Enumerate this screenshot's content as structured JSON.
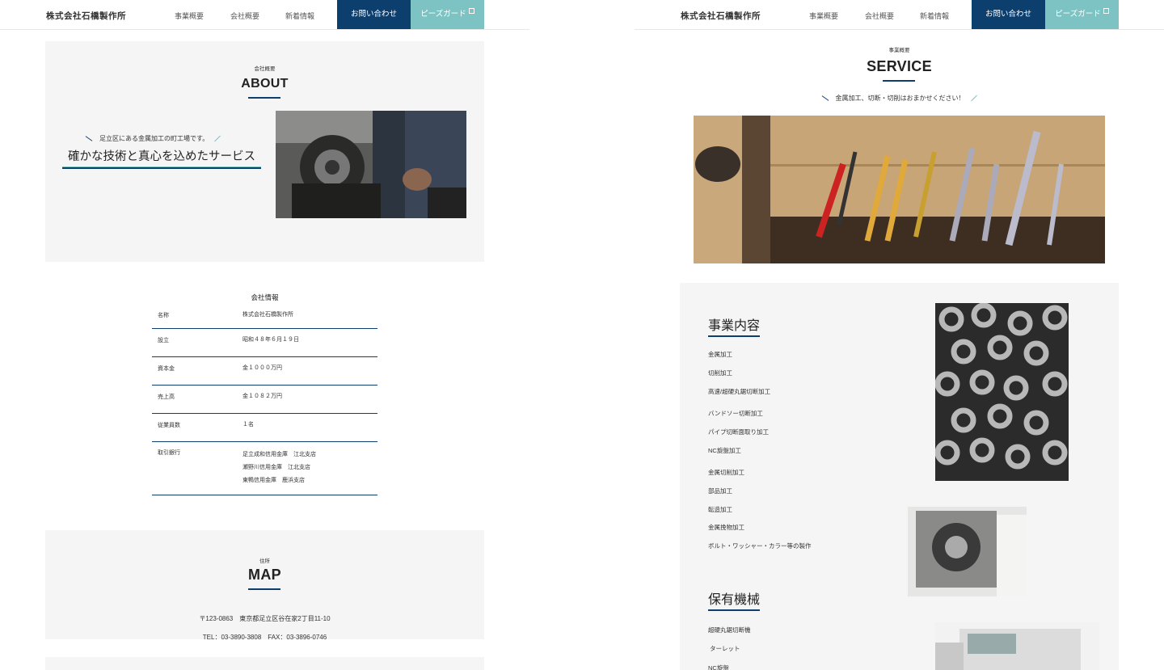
{
  "header": {
    "logo": "株式会社石橋製作所",
    "nav": [
      "事業概要",
      "会社概要",
      "新着情報"
    ],
    "contact": "お問い合わせ",
    "guard": "ピーズガード"
  },
  "about": {
    "small": "会社概要",
    "title": "ABOUT",
    "tagline": "足立区にある金属加工の町工場です。",
    "catch": "確かな技術と真心を込めたサービス"
  },
  "company": {
    "title": "会社情報",
    "rows": [
      {
        "key": "名称",
        "val": "株式会社石橋製作所"
      },
      {
        "key": "設立",
        "val": "昭和４８年６月１９日"
      },
      {
        "key": "資本金",
        "val": "金１０００万円"
      },
      {
        "key": "売上高",
        "val": "金１０８２万円"
      },
      {
        "key": "従業員数",
        "val": "１名"
      },
      {
        "key": "取引銀行",
        "lines": [
          "足立成和信用金庫　江北支店",
          "瀬野川信用金庫　江北支店",
          "東鴨信用金庫　鹿浜支店"
        ]
      }
    ]
  },
  "map": {
    "small": "住所",
    "title": "MAP",
    "address": "〒123-0863　東京都足立区谷在家2丁目11-10",
    "tel": "TEL：03-3890-3808　FAX：03-3896-0746"
  },
  "service": {
    "small": "事業概要",
    "title": "SERVICE",
    "sub": "金属加工、切断・切削はおまかせください！",
    "heading1": "事業内容",
    "items": [
      "金属加工",
      "切削加工",
      "高速/超硬丸鋸切断加工",
      "バンドソー切断加工",
      "パイプ切断面取り加工",
      "NC旋盤加工",
      "金属切削加工",
      "部品加工",
      "転造加工",
      "金属挽物加工",
      "ボルト・ワッシャー・カラー等の製作"
    ],
    "heading2": "保有機械",
    "machines": [
      "超硬丸鋸切断機",
      "ターレット",
      "NC旋盤"
    ]
  }
}
